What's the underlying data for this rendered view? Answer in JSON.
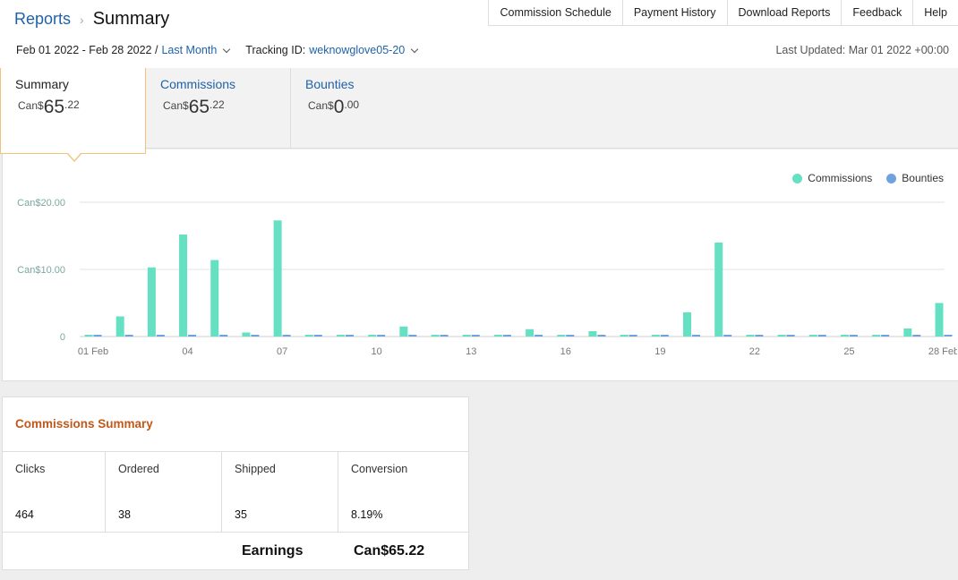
{
  "breadcrumb": {
    "root": "Reports",
    "separator": "›",
    "current": "Summary"
  },
  "topnav": [
    "Commission Schedule",
    "Payment History",
    "Download Reports",
    "Feedback",
    "Help"
  ],
  "filters": {
    "date_range": "Feb 01 2022 - Feb 28 2022 /",
    "range_preset": "Last Month",
    "tracking_label": "Tracking ID:",
    "tracking_id": "weknowglove05-20"
  },
  "last_updated": "Last Updated: Mar 01 2022 +00:00",
  "tabs": {
    "summary": {
      "title": "Summary",
      "currency": "Can$",
      "whole": "65",
      "cents": ".22"
    },
    "commissions": {
      "title": "Commissions",
      "currency": "Can$",
      "whole": "65",
      "cents": ".22"
    },
    "bounties": {
      "title": "Bounties",
      "currency": "Can$",
      "whole": "0",
      "cents": ".00"
    }
  },
  "legend": {
    "commissions": "Commissions",
    "bounties": "Bounties"
  },
  "colors": {
    "commissions": "#66e0c2",
    "bounties": "#6fa3e0",
    "link": "#1f62a8",
    "accent": "#c0581a"
  },
  "chart_data": {
    "type": "bar",
    "x": [
      "01 Feb",
      "02",
      "03",
      "04",
      "05",
      "06",
      "07",
      "08",
      "09",
      "10",
      "11",
      "12",
      "13",
      "14",
      "15",
      "16",
      "17",
      "18",
      "19",
      "20",
      "21",
      "22",
      "23",
      "24",
      "25",
      "26",
      "27",
      "28 Feb"
    ],
    "tick_labels": [
      {
        "index": 0,
        "label": "01 Feb"
      },
      {
        "index": 3,
        "label": "04"
      },
      {
        "index": 6,
        "label": "07"
      },
      {
        "index": 9,
        "label": "10"
      },
      {
        "index": 12,
        "label": "13"
      },
      {
        "index": 15,
        "label": "16"
      },
      {
        "index": 18,
        "label": "19"
      },
      {
        "index": 21,
        "label": "22"
      },
      {
        "index": 24,
        "label": "25"
      },
      {
        "index": 27,
        "label": "28 Feb"
      }
    ],
    "series": [
      {
        "name": "Commissions",
        "values": [
          0.2,
          3.0,
          10.3,
          15.2,
          11.4,
          0.6,
          17.3,
          0.2,
          0.1,
          0.2,
          1.5,
          0.2,
          0.2,
          0.2,
          1.1,
          0.2,
          0.8,
          0.2,
          0.2,
          3.6,
          14.0,
          0.2,
          0.2,
          0.1,
          0.2,
          0.2,
          1.2,
          5.0
        ]
      },
      {
        "name": "Bounties",
        "values": [
          0.2,
          0.2,
          0.2,
          0.2,
          0.2,
          0.2,
          0.2,
          0.2,
          0.2,
          0.2,
          0.2,
          0.2,
          0.2,
          0.2,
          0.2,
          0.2,
          0.2,
          0.2,
          0.2,
          0.2,
          0.2,
          0.2,
          0.2,
          0.2,
          0.2,
          0.2,
          0.2,
          0.2
        ]
      }
    ],
    "y_ticks": [
      {
        "value": 0,
        "label": "0"
      },
      {
        "value": 10,
        "label": "Can$10.00"
      },
      {
        "value": 20,
        "label": "Can$20.00"
      }
    ],
    "ylim": [
      0,
      20
    ],
    "grid": true,
    "legend": "top-right"
  },
  "commissions_summary": {
    "title": "Commissions Summary",
    "stats": [
      {
        "label": "Clicks",
        "value": "464"
      },
      {
        "label": "Ordered",
        "value": "38"
      },
      {
        "label": "Shipped",
        "value": "35"
      },
      {
        "label": "Conversion",
        "value": "8.19%"
      }
    ],
    "earnings_label": "Earnings",
    "earnings_value": "Can$65.22"
  }
}
